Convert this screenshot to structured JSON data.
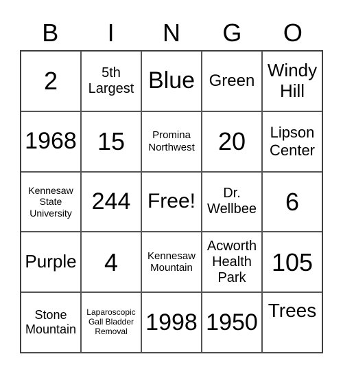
{
  "header": [
    "B",
    "I",
    "N",
    "G",
    "O"
  ],
  "cells": [
    "2",
    "5th Largest",
    "Blue",
    "Green",
    "Windy Hill",
    "1968",
    "15",
    "Promina Northwest",
    "20",
    "Lipson Center",
    "Kennesaw State University",
    "244",
    "Free!",
    "Dr. Wellbee",
    "6",
    "Purple",
    "4",
    "Kennesaw Mountain",
    "Acworth Health Park",
    "105",
    "Stone Mountain",
    "Laparoscopic Gall Bladder Removal",
    "1998",
    "1950",
    "Trees"
  ]
}
